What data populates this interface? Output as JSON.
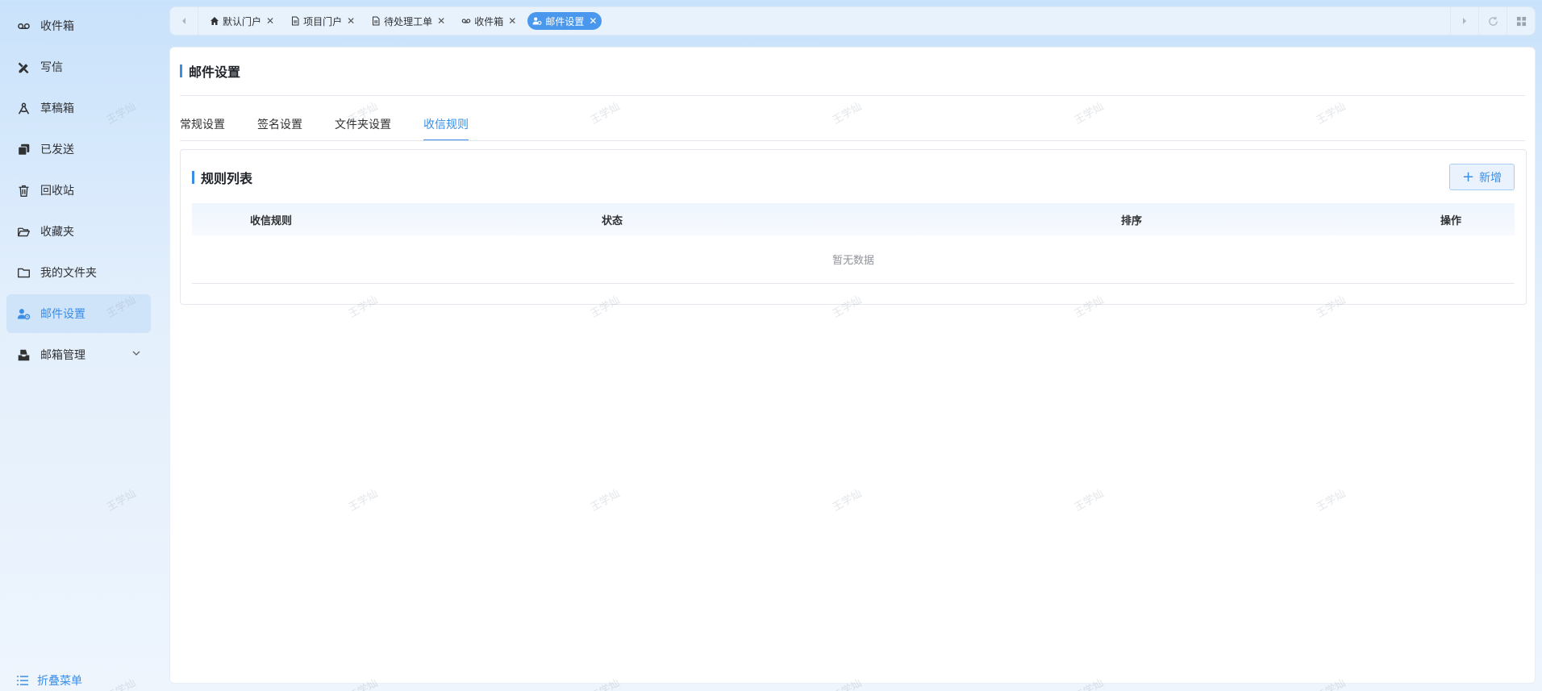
{
  "sidebar": {
    "items": [
      {
        "label": "收件箱",
        "icon": "voicemail-icon"
      },
      {
        "label": "写信",
        "icon": "pen-ruler-icon"
      },
      {
        "label": "草稿箱",
        "icon": "compass-icon"
      },
      {
        "label": "已发送",
        "icon": "copy-icon"
      },
      {
        "label": "回收站",
        "icon": "trash-icon"
      },
      {
        "label": "收藏夹",
        "icon": "folder-open-icon"
      },
      {
        "label": "我的文件夹",
        "icon": "folder-icon"
      },
      {
        "label": "邮件设置",
        "icon": "user-gear-icon"
      },
      {
        "label": "邮箱管理",
        "icon": "inbox-stack-icon"
      }
    ],
    "active_index": 7,
    "collapse_label": "折叠菜单"
  },
  "tabbar": {
    "tabs": [
      {
        "label": "默认门户",
        "icon": "home-icon"
      },
      {
        "label": "项目门户",
        "icon": "document-icon"
      },
      {
        "label": "待处理工单",
        "icon": "document-icon"
      },
      {
        "label": "收件箱",
        "icon": "voicemail-icon"
      },
      {
        "label": "邮件设置",
        "icon": "user-gear-icon"
      }
    ],
    "active_tab": "邮件设置"
  },
  "main": {
    "page_title": "邮件设置",
    "tabs": [
      {
        "label": "常规设置"
      },
      {
        "label": "签名设置"
      },
      {
        "label": "文件夹设置"
      },
      {
        "label": "收信规则"
      }
    ],
    "active_tab": "收信规则",
    "section_title": "规则列表",
    "add_button": "新增",
    "table": {
      "columns": [
        "收信规则",
        "状态",
        "排序",
        "操作"
      ],
      "empty_text": "暂无数据"
    }
  },
  "watermark": "王学灿",
  "colors": {
    "accent": "#3a8ee6",
    "active_tab_bg": "#4a98ee"
  }
}
